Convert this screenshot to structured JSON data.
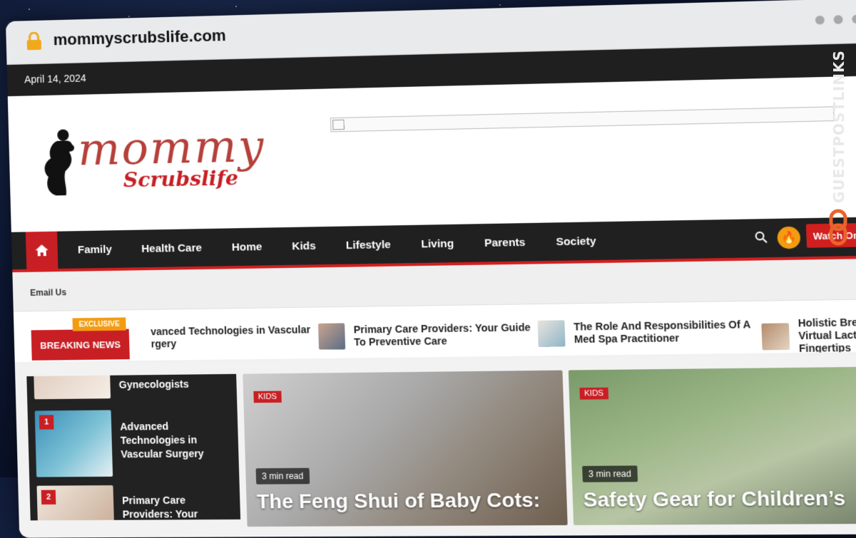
{
  "browser": {
    "url": "mommyscrubslife.com"
  },
  "topbar": {
    "date": "April 14, 2024"
  },
  "logo": {
    "main": "mommy",
    "sub": "Scrubslife"
  },
  "nav": {
    "items": [
      "Family",
      "Health Care",
      "Home",
      "Kids",
      "Lifestyle",
      "Living",
      "Parents",
      "Society"
    ],
    "watch_online": "Watch Online"
  },
  "subnav": {
    "email_us": "Email Us"
  },
  "ticker": {
    "exclusive_label": "EXCLUSIVE",
    "breaking_label": "BREAKING NEWS",
    "items": [
      {
        "title": "vanced Technologies in Vascular rgery"
      },
      {
        "title": "Primary Care Providers: Your Guide To Preventive Care"
      },
      {
        "title": "The Role And Responsibilities Of A Med Spa Practitioner"
      },
      {
        "title": "Holistic Breastf Virtual Lactatio Fingertips"
      }
    ]
  },
  "sidebar": {
    "items": [
      {
        "num": "",
        "title": "Gynecologists"
      },
      {
        "num": "1",
        "title": "Advanced Technologies in Vascular Surgery"
      },
      {
        "num": "2",
        "title": "Primary Care Providers: Your"
      }
    ]
  },
  "cards": [
    {
      "tag": "KIDS",
      "read_time": "3 min read",
      "title": "The Feng Shui of Baby Cots:"
    },
    {
      "tag": "KIDS",
      "read_time": "3 min read",
      "title": "Safety Gear for Children’s"
    }
  ],
  "watermark": {
    "text": "GUESTPOSTLINKS"
  },
  "colors": {
    "accent": "#c81f24",
    "dark": "#202020",
    "exclusive": "#f39c12"
  }
}
